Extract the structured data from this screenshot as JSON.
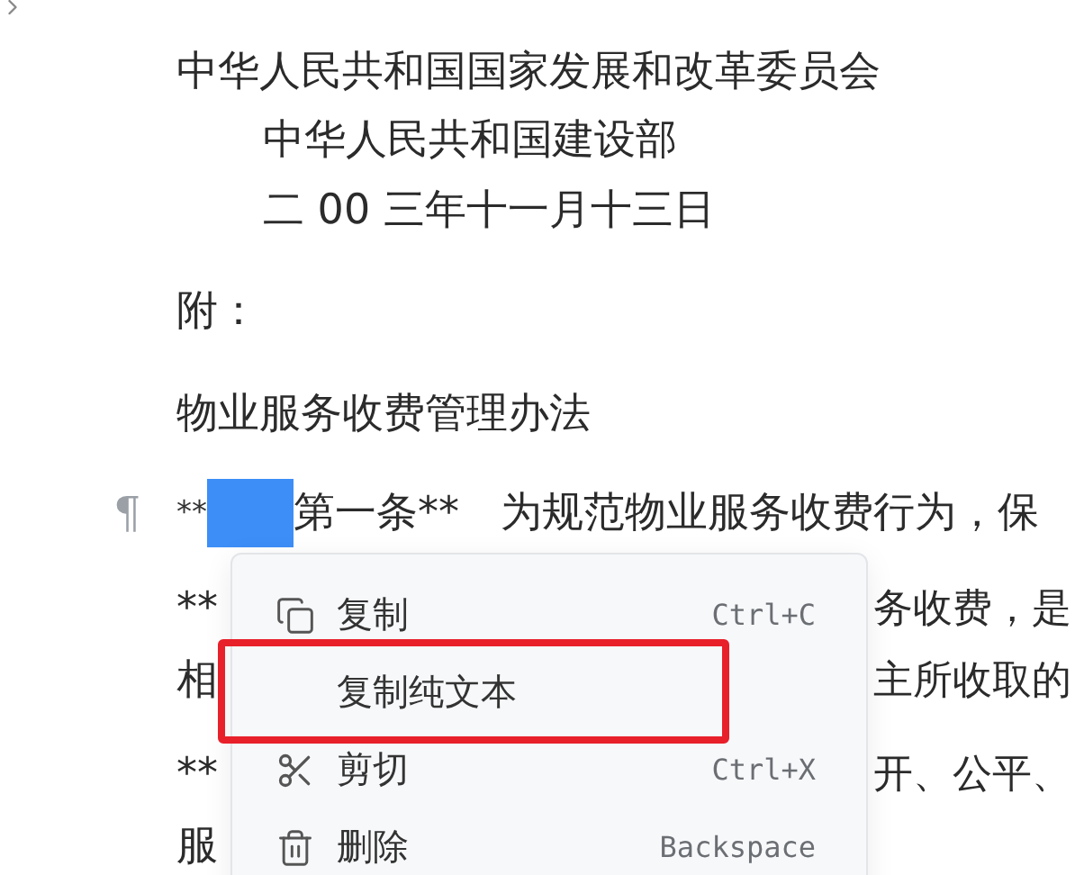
{
  "document": {
    "lines": [
      {
        "kind": "text",
        "indented": false,
        "text": "中华人民共和国国家发展和改革委员会"
      },
      {
        "kind": "text",
        "indented": true,
        "text": "中华人民共和国建设部"
      },
      {
        "kind": "text",
        "indented": true,
        "text": "二 00 三年十一月十三日"
      },
      {
        "kind": "text",
        "indented": false,
        "text": "附："
      },
      {
        "kind": "text",
        "indented": false,
        "text": "物业服务收费管理办法"
      },
      {
        "kind": "selected",
        "mark": "¶",
        "prefix": "**",
        "text": "第一条**　为规范物业服务收费行为，保"
      },
      {
        "kind": "covered",
        "left": "**",
        "right": "务收费，是"
      },
      {
        "kind": "covered",
        "left": "相",
        "right": "主所收取的"
      },
      {
        "kind": "covered",
        "left": "**",
        "right": "开、公平、"
      },
      {
        "kind": "covered",
        "left": "服"
      }
    ]
  },
  "context_menu": {
    "items": [
      {
        "kind": "copy",
        "label": "复制",
        "shortcut": "Ctrl+C",
        "highlighted": false
      },
      {
        "kind": "plain",
        "label": "复制纯文本",
        "highlighted": true
      },
      {
        "kind": "cut",
        "label": "剪切",
        "shortcut": "Ctrl+X",
        "highlighted": false
      },
      {
        "kind": "delete",
        "label": "删除",
        "shortcut": "Backspace",
        "highlighted": false
      }
    ]
  }
}
